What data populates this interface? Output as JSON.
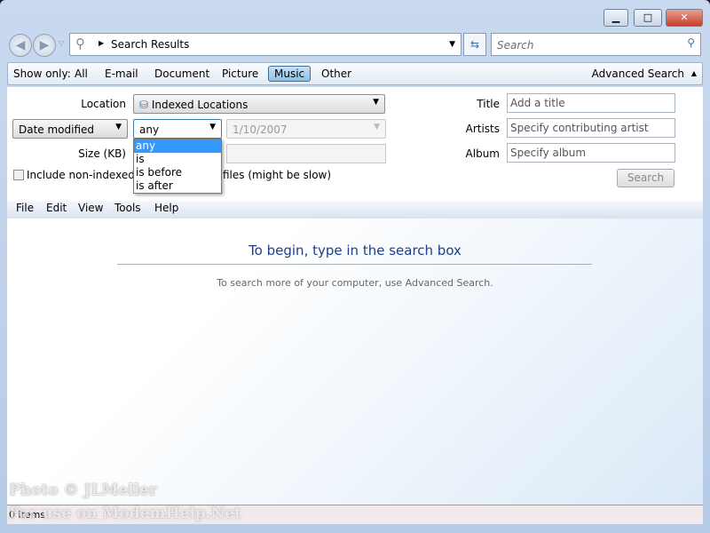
{
  "window": {
    "minimize": "▁",
    "maximize": "□",
    "close": "✕"
  },
  "address": {
    "path": "Search Results",
    "search_placeholder": "Search"
  },
  "show_only": {
    "label": "Show only:",
    "items": [
      "All",
      "E-mail",
      "Document",
      "Picture",
      "Music",
      "Other"
    ],
    "selected": "Music",
    "advanced": "Advanced Search"
  },
  "filters": {
    "location_label": "Location",
    "location_value": "Indexed Locations",
    "date_field": "Date modified",
    "date_op": "any",
    "date_value": "1/10/2007",
    "size_label": "Size (KB)",
    "include_label_left": "Include non-indexed, h",
    "include_label_right": "files (might be slow)",
    "dropdown_options": [
      "any",
      "is",
      "is before",
      "is after"
    ],
    "title_label": "Title",
    "title_placeholder": "Add a title",
    "artists_label": "Artists",
    "artists_placeholder": "Specify contributing artist",
    "album_label": "Album",
    "album_placeholder": "Specify album",
    "search_button": "Search"
  },
  "menu": [
    "File",
    "Edit",
    "View",
    "Tools",
    "Help"
  ],
  "content": {
    "heading": "To begin, type in the search box",
    "sub": "To search more of your computer, use Advanced Search."
  },
  "status": "0 items",
  "watermark": [
    "Photo © JLMeller",
    "For use on ModemHelp.Net"
  ]
}
